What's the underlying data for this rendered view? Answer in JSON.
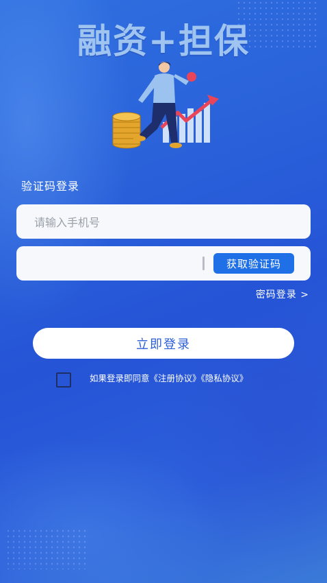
{
  "hero": {
    "title": "融资+担保"
  },
  "login": {
    "section_title": "验证码登录",
    "phone_placeholder": "请输入手机号",
    "code_value": "",
    "get_code_label": "获取验证码",
    "password_login_link": "密码登录 >",
    "submit_label": "立即登录",
    "agreement_prefix": "如果登录即同意",
    "register_agreement": "《注册协议》",
    "privacy_agreement": "《隐私协议》",
    "agreement_checked": false
  },
  "colors": {
    "background": "#2a62da",
    "accent_button": "#1f6fe6",
    "title_text": "#9fc4f0",
    "login_button_text": "#2c5ed6"
  },
  "icons": {
    "illustration": "finance-man-coins-chart-illustration"
  }
}
